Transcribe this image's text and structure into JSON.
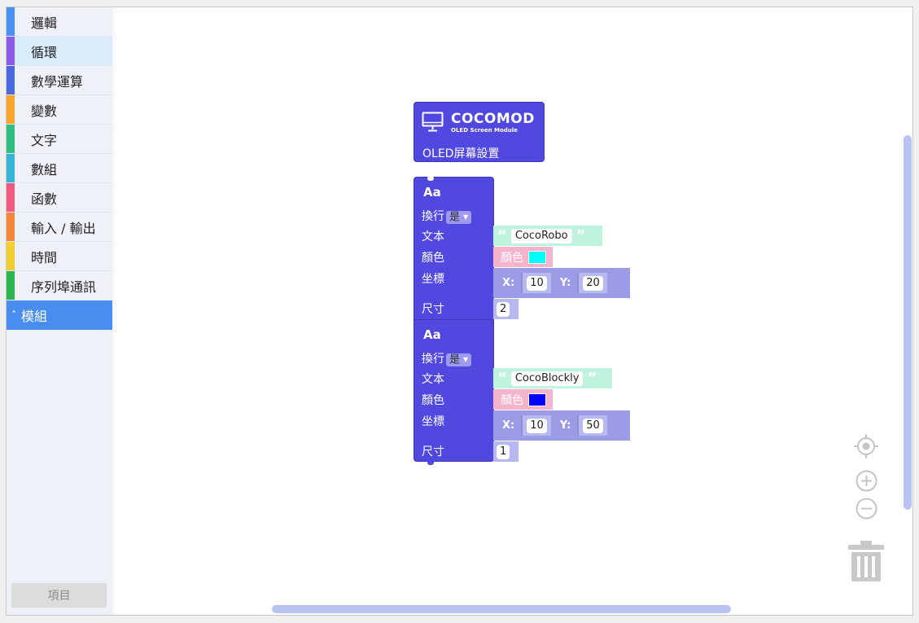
{
  "toolbox": {
    "categories": [
      {
        "label": "邏輯",
        "color": "#4a90f0"
      },
      {
        "label": "循環",
        "color": "#8c5ce8"
      },
      {
        "label": "數學運算",
        "color": "#4c68e0"
      },
      {
        "label": "變數",
        "color": "#f7a42c"
      },
      {
        "label": "文字",
        "color": "#2fbf82"
      },
      {
        "label": "數組",
        "color": "#39b4d8"
      },
      {
        "label": "函數",
        "color": "#ef5a80"
      },
      {
        "label": "輸入 / 輸出",
        "color": "#f5863a"
      },
      {
        "label": "時間",
        "color": "#f4cd2e"
      },
      {
        "label": "序列埠通訊",
        "color": "#2cb44e"
      }
    ],
    "selected_index": 1,
    "module_label": "模組",
    "module_caret": "^",
    "project_button": "項目"
  },
  "header_block": {
    "brand": "COCOMOD",
    "subtitle": "OLED Screen Module",
    "title": "OLED屏幕設置",
    "icon": "monitor-icon",
    "color": "#5148e0"
  },
  "text_blocks": [
    {
      "label": "Aa",
      "wrap_label": "換行",
      "wrap_value": "是",
      "text_label": "文本",
      "text_value": "CocoRobo",
      "color_label": "顏色",
      "color_field_label": "顏色",
      "color_value": "#00ffff",
      "coord_label": "坐標",
      "x_label": "X:",
      "x_value": "10",
      "y_label": "Y:",
      "y_value": "20",
      "size_label": "尺寸",
      "size_value": "2"
    },
    {
      "label": "Aa",
      "wrap_label": "換行",
      "wrap_value": "是",
      "text_label": "文本",
      "text_value": "CocoBlockly",
      "color_label": "顏色",
      "color_field_label": "顏色",
      "color_value": "#0000ff",
      "coord_label": "坐標",
      "x_label": "X:",
      "x_value": "10",
      "y_label": "Y:",
      "y_value": "50",
      "size_label": "尺寸",
      "size_value": "1"
    }
  ],
  "workspace_controls": [
    "recenter-icon",
    "zoom-in-icon",
    "zoom-out-icon",
    "trash-icon"
  ]
}
